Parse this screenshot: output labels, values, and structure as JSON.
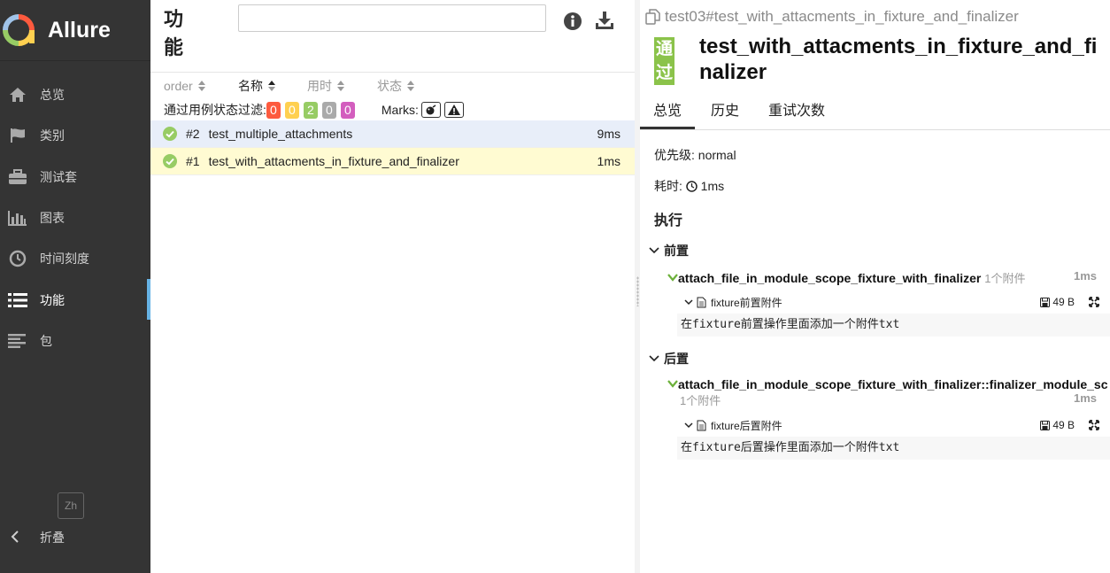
{
  "app": {
    "name": "Allure"
  },
  "sidebar": {
    "items": [
      {
        "label": "总览",
        "icon": "home-icon"
      },
      {
        "label": "类别",
        "icon": "flag-icon"
      },
      {
        "label": "测试套",
        "icon": "briefcase-icon"
      },
      {
        "label": "图表",
        "icon": "bar-chart-icon"
      },
      {
        "label": "时间刻度",
        "icon": "clock-icon"
      },
      {
        "label": "功能",
        "icon": "list-icon",
        "active": true
      },
      {
        "label": "包",
        "icon": "align-left-icon"
      }
    ],
    "language": "Zh",
    "collapse_label": "折叠"
  },
  "list_pane": {
    "title": "功能",
    "search": {
      "value": "",
      "placeholder": ""
    },
    "sort_columns": [
      "order",
      "名称",
      "用时",
      "状态"
    ],
    "filter_label": "通过用例状态过滤:",
    "status_counts": [
      {
        "value": "0",
        "color": "#fd5a3e"
      },
      {
        "value": "0",
        "color": "#ffd050"
      },
      {
        "value": "2",
        "color": "#97cc64"
      },
      {
        "value": "0",
        "color": "#aaaaaa"
      },
      {
        "value": "0",
        "color": "#d35ebe"
      }
    ],
    "marks_label": "Marks:",
    "rows": [
      {
        "num": "#2",
        "name": "test_multiple_attachments",
        "duration": "9ms",
        "bg": "#e8eef9"
      },
      {
        "num": "#1",
        "name": "test_with_attacments_in_fixture_and_finalizer",
        "duration": "1ms",
        "bg": "#fffbd2"
      }
    ]
  },
  "detail": {
    "breadcrumb": "test03#test_with_attacments_in_fixture_and_finalizer",
    "status": "通过",
    "status_color": "#8bc34a",
    "title": "test_with_attacments_in_fixture_and_finalizer",
    "tabs": [
      "总览",
      "历史",
      "重试次数"
    ],
    "severity_label": "优先级:",
    "severity_value": "normal",
    "duration_label": "耗时:",
    "duration_value": "1ms",
    "execution_title": "执行",
    "setup": {
      "label": "前置",
      "step_name": "attach_file_in_module_scope_fixture_with_finalizer",
      "attachments_count": "1个附件",
      "duration": "1ms",
      "attachment_name": "fixture前置附件",
      "attachment_size": "49 B",
      "attachment_content": "在fixture前置操作里面添加一个附件txt"
    },
    "teardown": {
      "label": "后置",
      "step_name": "attach_file_in_module_scope_fixture_with_finalizer::finalizer_module_sc",
      "attachments_count": "1个附件",
      "duration": "1ms",
      "attachment_name": "fixture后置附件",
      "attachment_size": "49 B",
      "attachment_content": "在fixture后置操作里面添加一个附件txt"
    }
  }
}
